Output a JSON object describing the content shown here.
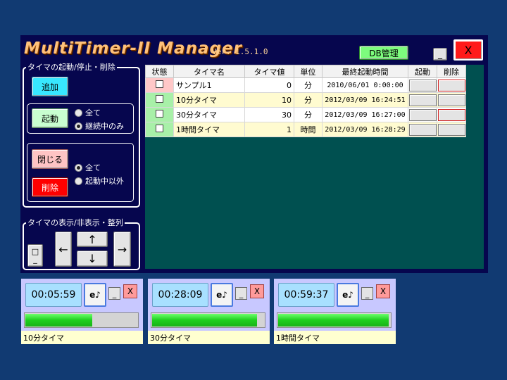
{
  "app": {
    "title": "MultiTimer-II Manager",
    "version": "Ver. 1.5.1.0",
    "db_button": "DB管理",
    "minimize": "_",
    "close": "X"
  },
  "controls": {
    "start_stop_delete_legend": "タイマの起動/停止・削除",
    "add_button": "追加",
    "start_button": "起動",
    "start_options": [
      "全て",
      "継続中のみ"
    ],
    "start_selected": "継続中のみ",
    "close_button": "閉じる",
    "delete_button": "削除",
    "close_options": [
      "全て",
      "起動中以外"
    ],
    "close_selected": "全て",
    "display_legend": "タイマの表示/非表示・整列",
    "toggle_display": "□\n_",
    "arrow_left": "←",
    "arrow_up": "↑",
    "arrow_down": "↓",
    "arrow_right": "→"
  },
  "table": {
    "headers": [
      "状態",
      "タイマ名",
      "タイマ値",
      "単位",
      "最終起動時間",
      "起動",
      "削除"
    ],
    "rows": [
      {
        "name": "サンプル1",
        "value": "0",
        "unit": "分",
        "last_start": "2010/06/01 0:00:00"
      },
      {
        "name": "10分タイマ",
        "value": "10",
        "unit": "分",
        "last_start": "2012/03/09 16:24:51"
      },
      {
        "name": "30分タイマ",
        "value": "30",
        "unit": "分",
        "last_start": "2012/03/09 16:27:00"
      },
      {
        "name": "1時間タイマ",
        "value": "1",
        "unit": "時間",
        "last_start": "2012/03/09 16:28:29"
      }
    ]
  },
  "timer_windows": [
    {
      "time": "00:05:59",
      "e_label": "e♪",
      "min": "_",
      "close": "X",
      "progress": 0.6,
      "name": "10分タイマ"
    },
    {
      "time": "00:28:09",
      "e_label": "e♪",
      "min": "_",
      "close": "X",
      "progress": 0.94,
      "name": "30分タイマ"
    },
    {
      "time": "00:59:37",
      "e_label": "e♪",
      "min": "_",
      "close": "X",
      "progress": 0.99,
      "name": "1時間タイマ"
    }
  ],
  "colors": {
    "desktop": "#113a72",
    "window": "#06064e",
    "table_bg": "#005050",
    "progress": "#1ecf1e"
  }
}
